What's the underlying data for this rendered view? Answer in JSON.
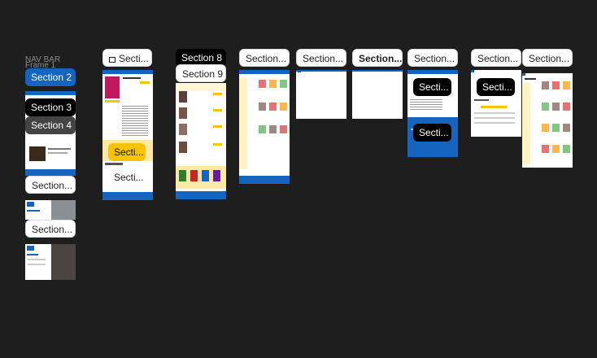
{
  "left_column": {
    "header_labels": [
      "NAV BAR",
      "Frame 1"
    ],
    "tags": [
      "Section 2",
      "Section 3",
      "Section 4",
      "Section...",
      "Section..."
    ]
  },
  "top_tags": [
    "Secti...",
    "Section 8",
    "Section 9",
    "Section...",
    "Section...",
    "Section...",
    "Section...",
    "Section...",
    "Section..."
  ],
  "inner_tags": [
    "Secti...",
    "Secti...",
    "Secti...",
    "Secti...",
    "Secti..."
  ]
}
